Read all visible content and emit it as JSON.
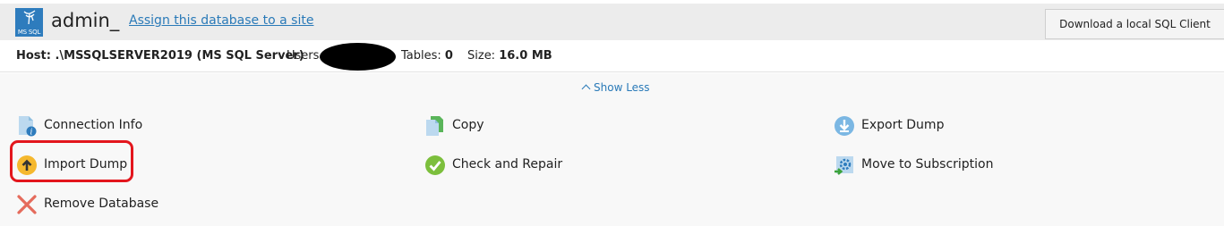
{
  "header": {
    "logo_text": "MS SQL",
    "db_name": "admin_",
    "assign_link": "Assign this database to a site",
    "download_button": "Download a local SQL Client"
  },
  "info": {
    "host_label": "Host: .\\MSSQLSERVER2019 (MS SQL Server)",
    "users_label": "Users",
    "tables_label": "Tables:",
    "tables_value": "0",
    "size_label": "Size:",
    "size_value": "16.0 MB"
  },
  "toggle": {
    "show_less": "Show Less"
  },
  "actions": {
    "connection_info": "Connection Info",
    "copy": "Copy",
    "export_dump": "Export Dump",
    "import_dump": "Import Dump",
    "check_repair": "Check and Repair",
    "move_subscription": "Move to Subscription",
    "remove_database": "Remove Database"
  },
  "colors": {
    "link": "#2a7ab8",
    "highlight": "#e3161d",
    "header_bg": "#ececec"
  }
}
